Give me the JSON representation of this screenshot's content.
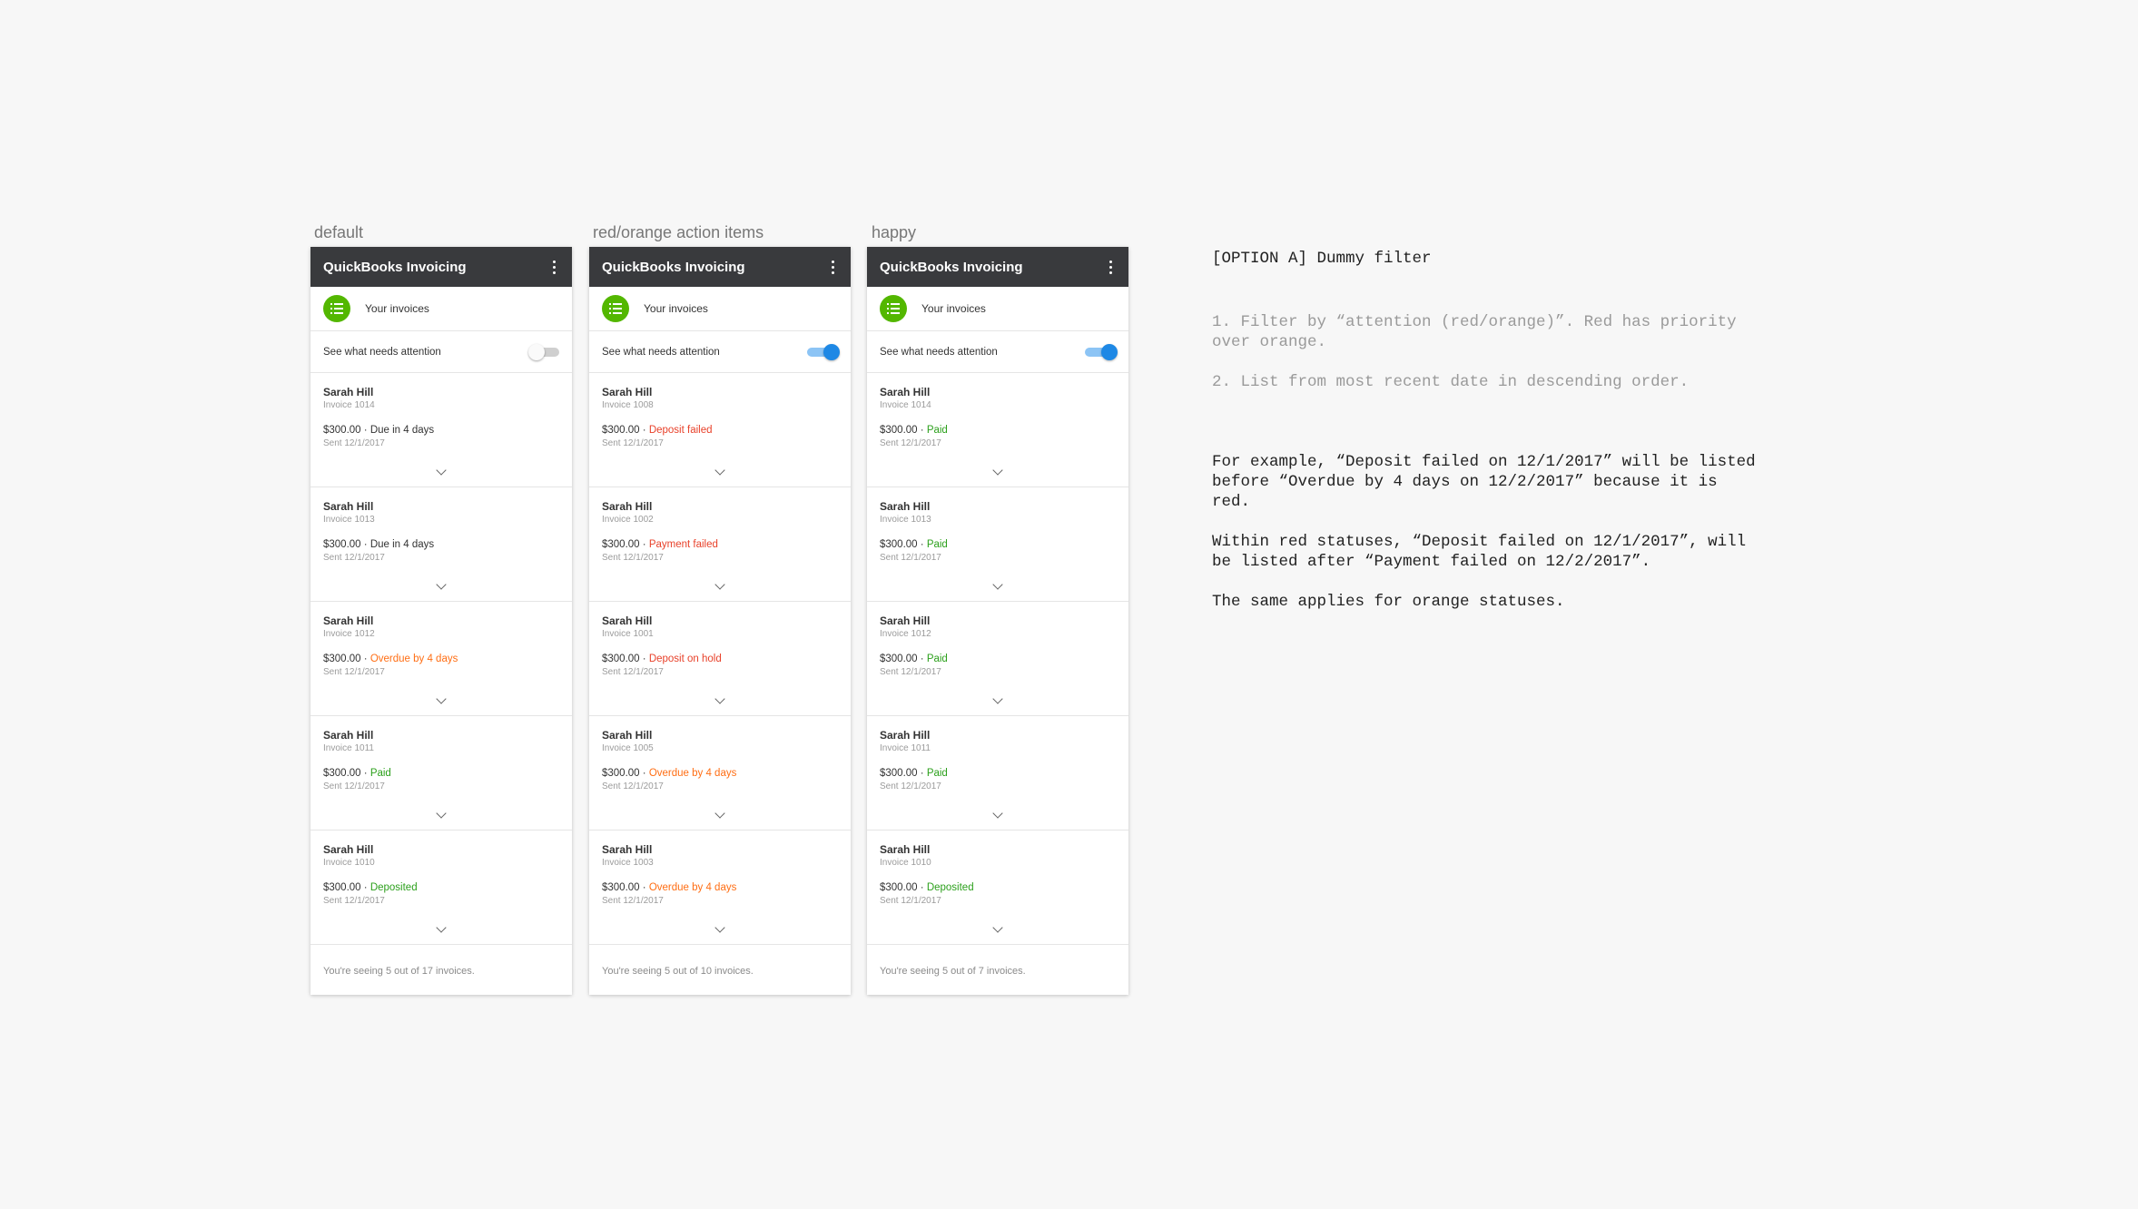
{
  "frames": [
    {
      "label": "default",
      "app_title": "QuickBooks Invoicing",
      "your_invoices": "Your invoices",
      "attention_label": "See what needs attention",
      "toggle_on": false,
      "invoices": [
        {
          "name": "Sarah Hill",
          "number": "Invoice 1014",
          "amount": "$300.00",
          "separator": " · ",
          "status": "Due in 4 days",
          "status_type": "neutral",
          "sent": "Sent 12/1/2017"
        },
        {
          "name": "Sarah Hill",
          "number": "Invoice 1013",
          "amount": "$300.00",
          "separator": " · ",
          "status": "Due in 4 days",
          "status_type": "neutral",
          "sent": "Sent 12/1/2017"
        },
        {
          "name": "Sarah Hill",
          "number": "Invoice 1012",
          "amount": "$300.00",
          "separator": " · ",
          "status": "Overdue by 4 days",
          "status_type": "orange",
          "sent": "Sent 12/1/2017"
        },
        {
          "name": "Sarah Hill",
          "number": "Invoice 1011",
          "amount": "$300.00",
          "separator": " · ",
          "status": "Paid",
          "status_type": "green",
          "sent": "Sent 12/1/2017"
        },
        {
          "name": "Sarah Hill",
          "number": "Invoice 1010",
          "amount": "$300.00",
          "separator": " · ",
          "status": "Deposited",
          "status_type": "green",
          "sent": "Sent 12/1/2017"
        }
      ],
      "footer": "You're seeing 5 out of 17 invoices."
    },
    {
      "label": "red/orange action items",
      "app_title": "QuickBooks Invoicing",
      "your_invoices": "Your invoices",
      "attention_label": "See what needs attention",
      "toggle_on": true,
      "invoices": [
        {
          "name": "Sarah Hill",
          "number": "Invoice 1008",
          "amount": "$300.00",
          "separator": " · ",
          "status": "Deposit failed",
          "status_type": "red",
          "sent": "Sent 12/1/2017"
        },
        {
          "name": "Sarah Hill",
          "number": "Invoice 1002",
          "amount": "$300.00",
          "separator": " · ",
          "status": "Payment failed",
          "status_type": "red",
          "sent": "Sent 12/1/2017"
        },
        {
          "name": "Sarah Hill",
          "number": "Invoice 1001",
          "amount": "$300.00",
          "separator": " · ",
          "status": "Deposit on hold",
          "status_type": "red",
          "sent": "Sent 12/1/2017"
        },
        {
          "name": "Sarah Hill",
          "number": "Invoice 1005",
          "amount": "$300.00",
          "separator": " · ",
          "status": "Overdue by 4 days",
          "status_type": "orange",
          "sent": "Sent 12/1/2017"
        },
        {
          "name": "Sarah Hill",
          "number": "Invoice 1003",
          "amount": "$300.00",
          "separator": " · ",
          "status": "Overdue by 4 days",
          "status_type": "orange",
          "sent": "Sent 12/1/2017"
        }
      ],
      "footer": "You're seeing 5 out of 10 invoices."
    },
    {
      "label": "happy",
      "app_title": "QuickBooks Invoicing",
      "your_invoices": "Your invoices",
      "attention_label": "See what needs attention",
      "toggle_on": true,
      "invoices": [
        {
          "name": "Sarah Hill",
          "number": "Invoice 1014",
          "amount": "$300.00",
          "separator": " · ",
          "status": "Paid",
          "status_type": "green",
          "sent": "Sent 12/1/2017"
        },
        {
          "name": "Sarah Hill",
          "number": "Invoice 1013",
          "amount": "$300.00",
          "separator": " · ",
          "status": "Paid",
          "status_type": "green",
          "sent": "Sent 12/1/2017"
        },
        {
          "name": "Sarah Hill",
          "number": "Invoice 1012",
          "amount": "$300.00",
          "separator": " · ",
          "status": "Paid",
          "status_type": "green",
          "sent": "Sent 12/1/2017"
        },
        {
          "name": "Sarah Hill",
          "number": "Invoice 1011",
          "amount": "$300.00",
          "separator": " · ",
          "status": "Paid",
          "status_type": "green",
          "sent": "Sent 12/1/2017"
        },
        {
          "name": "Sarah Hill",
          "number": "Invoice 1010",
          "amount": "$300.00",
          "separator": " · ",
          "status": "Deposited",
          "status_type": "green",
          "sent": "Sent 12/1/2017"
        }
      ],
      "footer": "You're seeing 5 out of 7 invoices."
    }
  ],
  "notes": {
    "heading": "[OPTION A] Dummy filter",
    "rules": [
      "1. Filter by “attention (red/orange)”. Red has priority over orange.",
      "2. List from most recent date in descending order."
    ],
    "paragraphs": [
      "For example, “Deposit failed on 12/1/2017” will be listed before “Overdue by 4 days on 12/2/2017” because it is red.",
      "Within red statuses, “Deposit failed on 12/1/2017”, will be listed after “Payment failed on 12/2/2017”.",
      "The same applies for orange statuses."
    ]
  },
  "colors": {
    "appbar": "#393a3d",
    "brand_green": "#53b700",
    "toggle_blue": "#1e88e5",
    "status_red": "#e8412a",
    "status_orange": "#ff6e14",
    "status_green": "#2ca01c"
  },
  "icons": {
    "menu": "kebab-menu-icon",
    "invoices": "list-icon",
    "expand": "chevron-down-icon"
  }
}
